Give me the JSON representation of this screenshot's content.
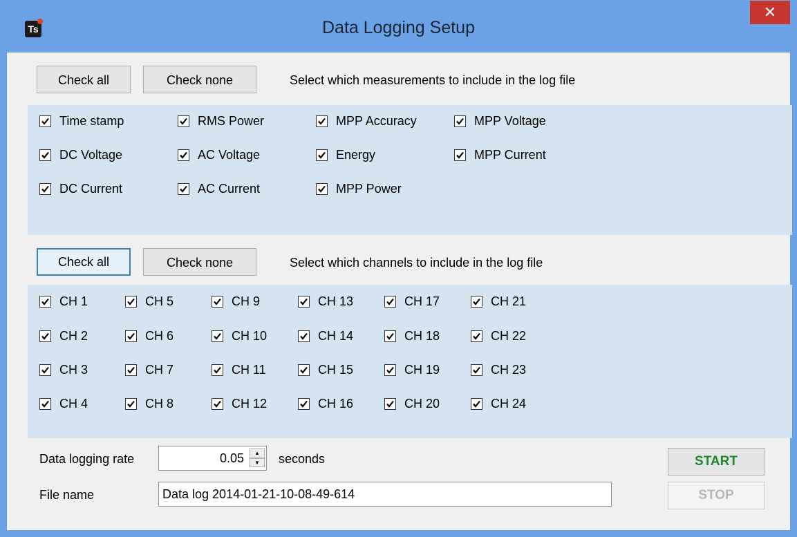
{
  "window": {
    "title": "Data Logging Setup",
    "app_icon_text": "Ts",
    "close_label": "✕"
  },
  "measurements": {
    "check_all_label": "Check all",
    "check_none_label": "Check none",
    "instruction": "Select which measurements to include in the log file",
    "items": [
      {
        "label": "Time stamp",
        "checked": true
      },
      {
        "label": "DC Voltage",
        "checked": true
      },
      {
        "label": "DC Current",
        "checked": true
      },
      {
        "label": "RMS Power",
        "checked": true
      },
      {
        "label": "AC Voltage",
        "checked": true
      },
      {
        "label": "AC Current",
        "checked": true
      },
      {
        "label": "MPP Accuracy",
        "checked": true
      },
      {
        "label": "Energy",
        "checked": true
      },
      {
        "label": "MPP Power",
        "checked": true
      },
      {
        "label": "MPP Voltage",
        "checked": true
      },
      {
        "label": "MPP Current",
        "checked": true
      }
    ]
  },
  "channels": {
    "check_all_label": "Check all",
    "check_none_label": "Check none",
    "instruction": "Select which channels to include in the log file",
    "items": [
      {
        "label": "CH 1",
        "checked": true
      },
      {
        "label": "CH 2",
        "checked": true
      },
      {
        "label": "CH 3",
        "checked": true
      },
      {
        "label": "CH 4",
        "checked": true
      },
      {
        "label": "CH 5",
        "checked": true
      },
      {
        "label": "CH 6",
        "checked": true
      },
      {
        "label": "CH 7",
        "checked": true
      },
      {
        "label": "CH 8",
        "checked": true
      },
      {
        "label": "CH 9",
        "checked": true
      },
      {
        "label": "CH 10",
        "checked": true
      },
      {
        "label": "CH 11",
        "checked": true
      },
      {
        "label": "CH 12",
        "checked": true
      },
      {
        "label": "CH 13",
        "checked": true
      },
      {
        "label": "CH 14",
        "checked": true
      },
      {
        "label": "CH 15",
        "checked": true
      },
      {
        "label": "CH 16",
        "checked": true
      },
      {
        "label": "CH 17",
        "checked": true
      },
      {
        "label": "CH 18",
        "checked": true
      },
      {
        "label": "CH 19",
        "checked": true
      },
      {
        "label": "CH 20",
        "checked": true
      },
      {
        "label": "CH 21",
        "checked": true
      },
      {
        "label": "CH 22",
        "checked": true
      },
      {
        "label": "CH 23",
        "checked": true
      },
      {
        "label": "CH 24",
        "checked": true
      }
    ]
  },
  "logging": {
    "rate_label": "Data logging rate",
    "rate_value": "0.05",
    "rate_unit": "seconds",
    "file_label": "File name",
    "file_value": "Data log 2014-01-21-10-08-49-614",
    "start_label": "START",
    "stop_label": "STOP"
  },
  "colors": {
    "title_bar": "#6ba2e6",
    "close_button": "#c7372f",
    "group_background": "#d6e4f2",
    "start_text": "#1f8a2c",
    "stop_text_disabled": "#b7b7b7"
  },
  "icons": [
    "app-icon",
    "close-icon",
    "check-icon",
    "spin-up-icon",
    "spin-down-icon"
  ]
}
